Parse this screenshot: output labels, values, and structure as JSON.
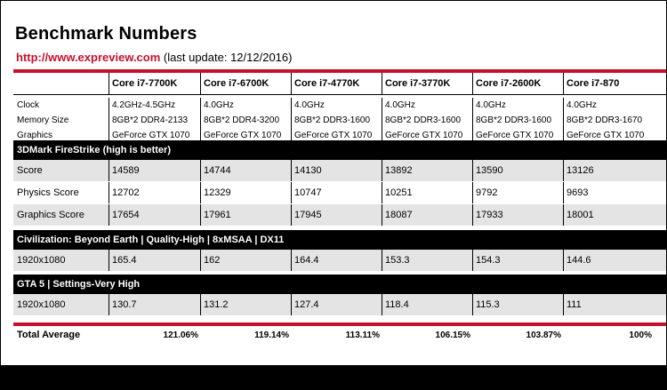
{
  "title": "Benchmark Numbers",
  "subtitle": {
    "url": "http://www.expreview.com",
    "note": "(last update: 12/12/2016)"
  },
  "cpus": [
    "Core i7-7700K",
    "Core i7-6700K",
    "Core i7-4770K",
    "Core i7-3770K",
    "Core i7-2600K",
    "Core i7-870"
  ],
  "spec_labels": [
    "Clock",
    "Memory Size",
    "Graphics"
  ],
  "specs": [
    [
      "4.2GHz-4.5GHz",
      "8GB*2 DDR4-2133",
      "GeForce GTX 1070"
    ],
    [
      "4.0GHz",
      "8GB*2 DDR4-3200",
      "GeForce GTX 1070"
    ],
    [
      "4.0GHz",
      "8GB*2 DDR3-1600",
      "GeForce GTX 1070"
    ],
    [
      "4.0GHz",
      "8GB*2 DDR3-1600",
      "GeForce GTX 1070"
    ],
    [
      "4.0GHz",
      "8GB*2 DDR3-1600",
      "GeForce GTX 1070"
    ],
    [
      "4.0GHz",
      "8GB*2 DDR3-1670",
      "GeForce GTX 1070"
    ]
  ],
  "sections": [
    {
      "title": "3DMark FireStrike (high is better)",
      "rows": [
        {
          "label": "Score",
          "values": [
            "14589",
            "14744",
            "14130",
            "13892",
            "13590",
            "13126"
          ]
        },
        {
          "label": "Physics Score",
          "values": [
            "12702",
            "12329",
            "10747",
            "10251",
            "9792",
            "9693"
          ]
        },
        {
          "label": "Graphics Score",
          "values": [
            "17654",
            "17961",
            "17945",
            "18087",
            "17933",
            "18001"
          ]
        }
      ]
    },
    {
      "title": "Civilization: Beyond Earth | Quality-High  |  8xMSAA  | DX11",
      "rows": [
        {
          "label": "1920x1080",
          "values": [
            "165.4",
            "162",
            "164.4",
            "153.3",
            "154.3",
            "144.6"
          ]
        }
      ]
    },
    {
      "title": "GTA 5 |  Settings-Very High",
      "rows": [
        {
          "label": "1920x1080",
          "values": [
            "130.7",
            "131.2",
            "127.4",
            "118.4",
            "115.3",
            "111"
          ]
        }
      ]
    }
  ],
  "total": {
    "label": "Total Average",
    "values": [
      "121.06%",
      "119.14%",
      "113.11%",
      "106.15%",
      "103.87%",
      "100%"
    ]
  },
  "colors": {
    "accent": "#c8102e",
    "row_gray": "#e4e4e4",
    "section_bg": "#000000"
  }
}
